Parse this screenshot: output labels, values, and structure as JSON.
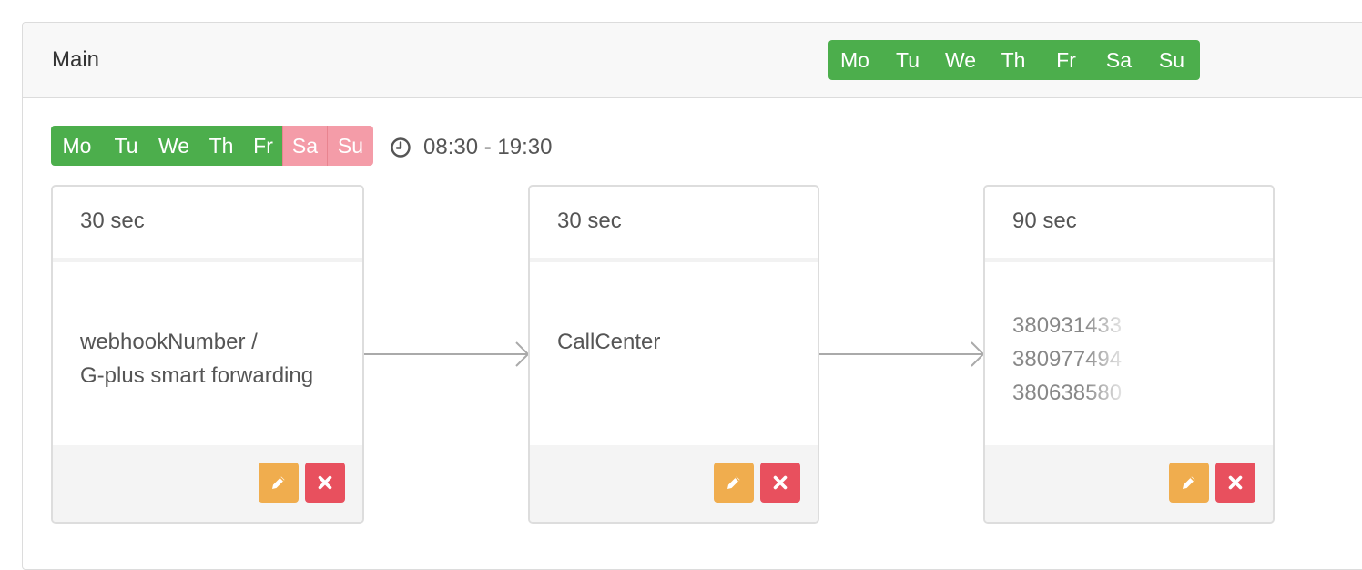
{
  "header": {
    "title": "Main",
    "days": [
      "Mo",
      "Tu",
      "We",
      "Th",
      "Fr",
      "Sa",
      "Su"
    ]
  },
  "schedule": {
    "days": [
      {
        "label": "Mo",
        "active": true
      },
      {
        "label": "Tu",
        "active": true
      },
      {
        "label": "We",
        "active": true
      },
      {
        "label": "Th",
        "active": true
      },
      {
        "label": "Fr",
        "active": true
      },
      {
        "label": "Sa",
        "active": false
      },
      {
        "label": "Su",
        "active": false
      }
    ],
    "time": "08:30 - 19:30"
  },
  "cards": [
    {
      "duration": "30 sec",
      "lines": [
        "webhookNumber /",
        "G-plus smart forwarding"
      ]
    },
    {
      "duration": "30 sec",
      "lines": [
        "CallCenter"
      ]
    },
    {
      "duration": "90 sec",
      "lines": [
        "380931433",
        "380977494",
        "380638580"
      ]
    }
  ],
  "colors": {
    "active_day": "#4cae4c",
    "inactive_day": "#f49ca8",
    "edit_button": "#f0ad4e",
    "delete_button": "#e8505e"
  },
  "icons": {
    "time": "clock-icon",
    "edit": "pencil-icon",
    "delete": "close-icon",
    "connector": "arrow-right-icon"
  }
}
